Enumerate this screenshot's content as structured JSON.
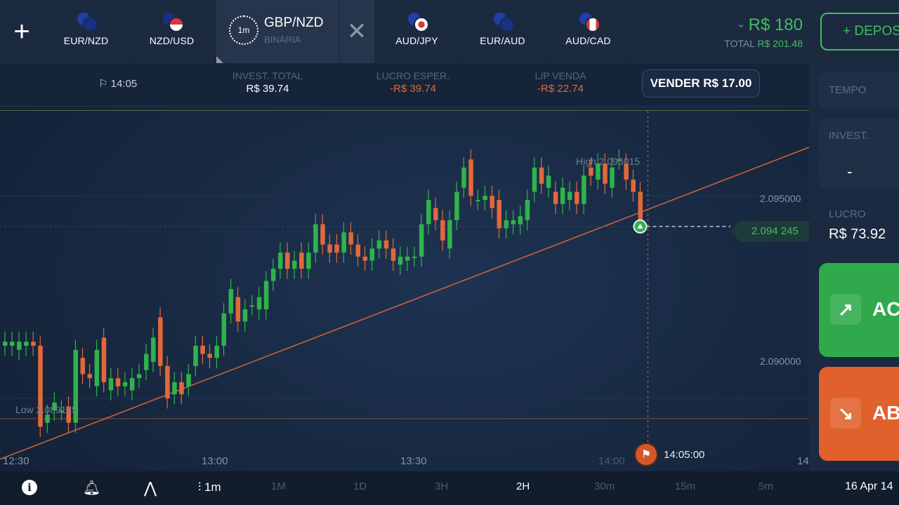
{
  "top_bar": {
    "add_label": "+",
    "assets": [
      {
        "label": "EUR/NZD",
        "flag1": "#1f3fa8",
        "flag2": "#1a2f86"
      },
      {
        "label": "NZD/USD",
        "flag1": "#1a2f86",
        "flag2": "#d63a3a"
      },
      {
        "label": "AUD/JPY",
        "flag1": "#1f3fa8",
        "flag2": "#ffffff"
      },
      {
        "label": "EUR/AUD",
        "flag1": "#1f3fa8",
        "flag2": "#1a2f86"
      },
      {
        "label": "AUD/CAD",
        "flag1": "#1f3fa8",
        "flag2": "#d63a3a"
      }
    ],
    "active_asset": {
      "timer": "1m",
      "name": "GBP/NZD",
      "type": "BINÁRIA",
      "close": "✕"
    },
    "balance": {
      "value": "R$ 180",
      "chevron": "⌄",
      "total_label": "TOTAL",
      "total_value": "R$ 201.48"
    },
    "deposit_label": "+ DEPOSITAR"
  },
  "info_bar": {
    "time": "14:05",
    "invest_total_label": "INVEST. TOTAL",
    "invest_total_value": "R$ 39.74",
    "expected_profit_label": "LUCRO ESPER.",
    "expected_profit_value": "-R$ 39.74",
    "pl_sell_label": "L/P VENDA",
    "pl_sell_value": "-R$ 22.74",
    "sell_button": "VENDER R$ 17.00"
  },
  "chart": {
    "high_label": "High 2.096015",
    "low_label": "Low 2.089125",
    "price_ticks": [
      "2.095000",
      "2.090000"
    ],
    "current_price": "2.094 245",
    "time_ticks": [
      "12:30",
      "13:00",
      "13:30",
      "14:00",
      "14"
    ],
    "expiry_time": "14:05:00",
    "up_color": "#2fb34a",
    "down_color": "#e2683a"
  },
  "chart_data": {
    "type": "candlestick",
    "title": "",
    "xlabel": "",
    "ylabel": "",
    "ylim": [
      2.0882,
      2.0971
    ],
    "high": 2.096015,
    "low": 2.089125,
    "current": 2.094245,
    "candles": [
      {
        "o": 2.0913,
        "c": 2.0914
      },
      {
        "o": 2.0913,
        "c": 2.0914
      },
      {
        "o": 2.0912,
        "c": 2.0914
      },
      {
        "o": 2.0913,
        "c": 2.0914
      },
      {
        "o": 2.0914,
        "c": 2.0913
      },
      {
        "o": 2.0913,
        "c": 2.0893
      },
      {
        "o": 2.0894,
        "c": 2.0896
      },
      {
        "o": 2.0897,
        "c": 2.0899
      },
      {
        "o": 2.0897,
        "c": 2.0897
      },
      {
        "o": 2.0898,
        "c": 2.0894
      },
      {
        "o": 2.0894,
        "c": 2.0912
      },
      {
        "o": 2.091,
        "c": 2.0906
      },
      {
        "o": 2.0906,
        "c": 2.0905
      },
      {
        "o": 2.0903,
        "c": 2.0912
      },
      {
        "o": 2.0915,
        "c": 2.0904
      },
      {
        "o": 2.0902,
        "c": 2.0905
      },
      {
        "o": 2.0905,
        "c": 2.0903
      },
      {
        "o": 2.0903,
        "c": 2.0904
      },
      {
        "o": 2.0902,
        "c": 2.0905
      },
      {
        "o": 2.0905,
        "c": 2.0906
      },
      {
        "o": 2.0907,
        "c": 2.0911
      },
      {
        "o": 2.0909,
        "c": 2.0915
      },
      {
        "o": 2.092,
        "c": 2.0908
      },
      {
        "o": 2.0908,
        "c": 2.09
      },
      {
        "o": 2.0901,
        "c": 2.0904
      },
      {
        "o": 2.0904,
        "c": 2.0901
      },
      {
        "o": 2.0903,
        "c": 2.0906
      },
      {
        "o": 2.0908,
        "c": 2.0913
      },
      {
        "o": 2.0913,
        "c": 2.0911
      },
      {
        "o": 2.0911,
        "c": 2.091
      },
      {
        "o": 2.091,
        "c": 2.0913
      },
      {
        "o": 2.0913,
        "c": 2.0921
      },
      {
        "o": 2.0921,
        "c": 2.0927
      },
      {
        "o": 2.0925,
        "c": 2.0919
      },
      {
        "o": 2.0919,
        "c": 2.0922
      },
      {
        "o": 2.0923,
        "c": 2.0923
      },
      {
        "o": 2.0922,
        "c": 2.0925
      },
      {
        "o": 2.0922,
        "c": 2.0929
      },
      {
        "o": 2.0929,
        "c": 2.0932
      },
      {
        "o": 2.0932,
        "c": 2.0936
      },
      {
        "o": 2.0936,
        "c": 2.0932
      },
      {
        "o": 2.0932,
        "c": 2.0934
      },
      {
        "o": 2.0936,
        "c": 2.0932
      },
      {
        "o": 2.0932,
        "c": 2.0936
      },
      {
        "o": 2.0936,
        "c": 2.0943
      },
      {
        "o": 2.0943,
        "c": 2.0938
      },
      {
        "o": 2.0938,
        "c": 2.0936
      },
      {
        "o": 2.0938,
        "c": 2.0936
      },
      {
        "o": 2.0936,
        "c": 2.0941
      },
      {
        "o": 2.0941,
        "c": 2.0938
      },
      {
        "o": 2.0938,
        "c": 2.0935
      },
      {
        "o": 2.0935,
        "c": 2.0934
      },
      {
        "o": 2.0934,
        "c": 2.0937
      },
      {
        "o": 2.0937,
        "c": 2.0939
      },
      {
        "o": 2.0939,
        "c": 2.0937
      },
      {
        "o": 2.0937,
        "c": 2.0934
      },
      {
        "o": 2.0933,
        "c": 2.0935
      },
      {
        "o": 2.0934,
        "c": 2.0935
      },
      {
        "o": 2.0935,
        "c": 2.0935
      },
      {
        "o": 2.0935,
        "c": 2.0943
      },
      {
        "o": 2.0943,
        "c": 2.0949
      },
      {
        "o": 2.0947,
        "c": 2.0944
      },
      {
        "o": 2.0944,
        "c": 2.0939
      },
      {
        "o": 2.0937,
        "c": 2.0944
      },
      {
        "o": 2.0944,
        "c": 2.0951
      },
      {
        "o": 2.0952,
        "c": 2.0957
      },
      {
        "o": 2.0959,
        "c": 2.095
      },
      {
        "o": 2.0949,
        "c": 2.0949
      },
      {
        "o": 2.0949,
        "c": 2.095
      },
      {
        "o": 2.095,
        "c": 2.0947
      },
      {
        "o": 2.0949,
        "c": 2.0942
      },
      {
        "o": 2.0942,
        "c": 2.0944
      },
      {
        "o": 2.0943,
        "c": 2.0944
      },
      {
        "o": 2.0943,
        "c": 2.0945
      },
      {
        "o": 2.0944,
        "c": 2.0949
      },
      {
        "o": 2.0951,
        "c": 2.0957
      },
      {
        "o": 2.0957,
        "c": 2.0953
      },
      {
        "o": 2.0952,
        "c": 2.0955
      },
      {
        "o": 2.0951,
        "c": 2.0948
      },
      {
        "o": 2.0948,
        "c": 2.0952
      },
      {
        "o": 2.0949,
        "c": 2.0951
      },
      {
        "o": 2.0951,
        "c": 2.0948
      },
      {
        "o": 2.0948,
        "c": 2.0955
      },
      {
        "o": 2.0957,
        "c": 2.0955
      },
      {
        "o": 2.0954,
        "c": 2.0958
      },
      {
        "o": 2.0958,
        "c": 2.0953
      },
      {
        "o": 2.0952,
        "c": 2.0957
      },
      {
        "o": 2.0959,
        "c": 2.0959
      },
      {
        "o": 2.0958,
        "c": 2.0954
      },
      {
        "o": 2.0954,
        "c": 2.0951
      },
      {
        "o": 2.0951,
        "c": 2.0944
      }
    ],
    "trendline": [
      {
        "x": 0,
        "y": 2.0885
      },
      {
        "x": 1,
        "y": 2.0962
      }
    ],
    "hline": 2.0895
  },
  "bottom_bar": {
    "candle_interval": "1m",
    "timeframes": [
      "1M",
      "1D",
      "3H",
      "2H",
      "30m",
      "15m",
      "5m"
    ],
    "active_timeframe": "2H",
    "date": "16 Apr 14"
  },
  "right_panel": {
    "tempo_label": "TEMPO",
    "invest_label": "INVEST.",
    "minus": "-",
    "lucro_label": "LUCRO",
    "lucro_value": "R$ 73.92",
    "up_label": "ACIMA",
    "down_label": "ABAIXO",
    "up_icon": "↗",
    "down_icon": "↘"
  }
}
